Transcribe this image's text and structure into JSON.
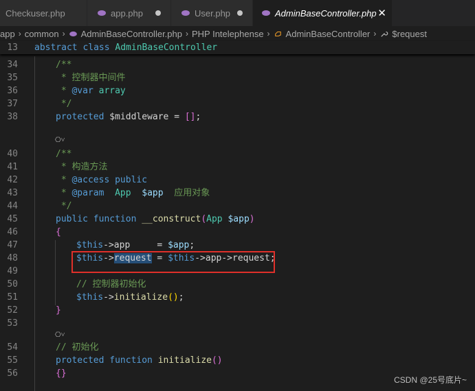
{
  "tabs": [
    {
      "label": "Checkuser.php"
    },
    {
      "label": "app.php"
    },
    {
      "label": "User.php"
    },
    {
      "label": "AdminBaseController.php",
      "close": "✕"
    }
  ],
  "breadcrumb": {
    "items": [
      "app",
      "common",
      "AdminBaseController.php",
      "PHP Intelephense",
      "AdminBaseController",
      "$request"
    ]
  },
  "sticky": {
    "num": "13",
    "kw": "abstract class",
    "name": "AdminBaseController"
  },
  "lines": {
    "n34": "34",
    "n35": "35",
    "n36": "36",
    "n37": "37",
    "n38": "38",
    "n40": "40",
    "n41": "41",
    "n42": "42",
    "n43": "43",
    "n44": "44",
    "n45": "45",
    "n46": "46",
    "n47": "47",
    "n48": "48",
    "n49": "49",
    "n50": "50",
    "n51": "51",
    "n52": "52",
    "n53": "53",
    "n54": "54",
    "n55": "55",
    "n56": "56",
    "l34": "/**",
    "l35": " * 控制器中间件",
    "l36a": " * ",
    "l36b": "@var",
    "l36c": " array",
    "l37": " */",
    "l38a": "protected",
    "l38b": " $middleware",
    "l38c": " = ",
    "l38d": "[]",
    "l38e": ";",
    "l40": "/**",
    "l41": " * 构造方法",
    "l42a": " * ",
    "l42b": "@access",
    "l42c": " public",
    "l43a": " * ",
    "l43b": "@param",
    "l43c": "  App",
    "l43d": "  $app",
    "l43e": "  应用对象",
    "l44": " */",
    "l45a": "public function",
    "l45b": " __construct",
    "l45c": "(",
    "l45d": "App",
    "l45e": " $app",
    "l45f": ")",
    "l46": "{",
    "l47a": "$this",
    "l47b": "->",
    "l47c": "app",
    "l47d": "     = ",
    "l47e": "$app",
    "l47f": ";",
    "l48a": "$this",
    "l48b": "->",
    "l48c": "request",
    "l48d": " = ",
    "l48e": "$this",
    "l48f": "->app->request;",
    "l50": "// 控制器初始化",
    "l51a": "$this",
    "l51b": "->",
    "l51c": "initialize",
    "l51d": "()",
    "l51e": ";",
    "l52": "}",
    "l54": "// 初始化",
    "l55a": "protected function",
    "l55b": " initialize",
    "l55c": "()",
    "l56": "{}"
  },
  "fold_glyph": "⎔˅",
  "watermark": "CSDN @25号底片~"
}
